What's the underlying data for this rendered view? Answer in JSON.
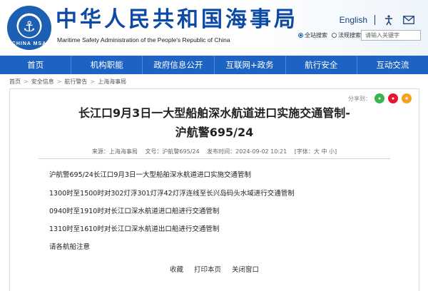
{
  "header": {
    "emblem_text": "CHINA MSA",
    "title": "中华人民共和国海事局",
    "subtitle": "Maritime Safety Administration of the People's Republic of China",
    "lang_link": "English",
    "icons": [
      "accessibility-icon",
      "mail-icon"
    ],
    "search": {
      "scope_site": "全站搜索",
      "scope_other": "法规搜索",
      "placeholder": "请输入关键字"
    }
  },
  "nav": {
    "items": [
      "首页",
      "机构职能",
      "政府信息公开",
      "互联网+政务",
      "航行安全",
      "互动交流"
    ]
  },
  "breadcrumb": {
    "items": [
      "首页",
      "安全信息",
      "航行警告",
      "上海海事局"
    ],
    "separator": ">"
  },
  "article": {
    "share_label": "分享到：",
    "share_icons": [
      "wechat-icon",
      "weibo-icon",
      "qzone-icon"
    ],
    "title_line1": "长江口9月3日一大型船舶深水航道进口实施交通管制-",
    "title_line2": "沪航警695/24",
    "meta": {
      "source": "来源：上海海事局",
      "doc_no": "文号：沪航警695/24",
      "publish_time": "发布时间：2024-09-02 10:21",
      "font_size": "[字体：大 中 小]"
    },
    "paragraphs": [
      "沪航警695/24长江口9月3日一大型船舶深水航道进口实施交通管制",
      "1300时至1500时对302灯浮301灯浮42灯浮连线至长兴岛码头水域进行交通管制",
      "0940时至1910时对长江口深水航道进口船进行交通管制",
      "1310时至1610时对长江口深水航道出口船进行交通管制",
      "请各航船注意"
    ],
    "footer": {
      "favorite": "收藏",
      "print": "打印本页",
      "close": "关闭窗口"
    }
  },
  "colors": {
    "brand_blue": "#0d4aa6",
    "nav_blue": "#1c63c4"
  }
}
